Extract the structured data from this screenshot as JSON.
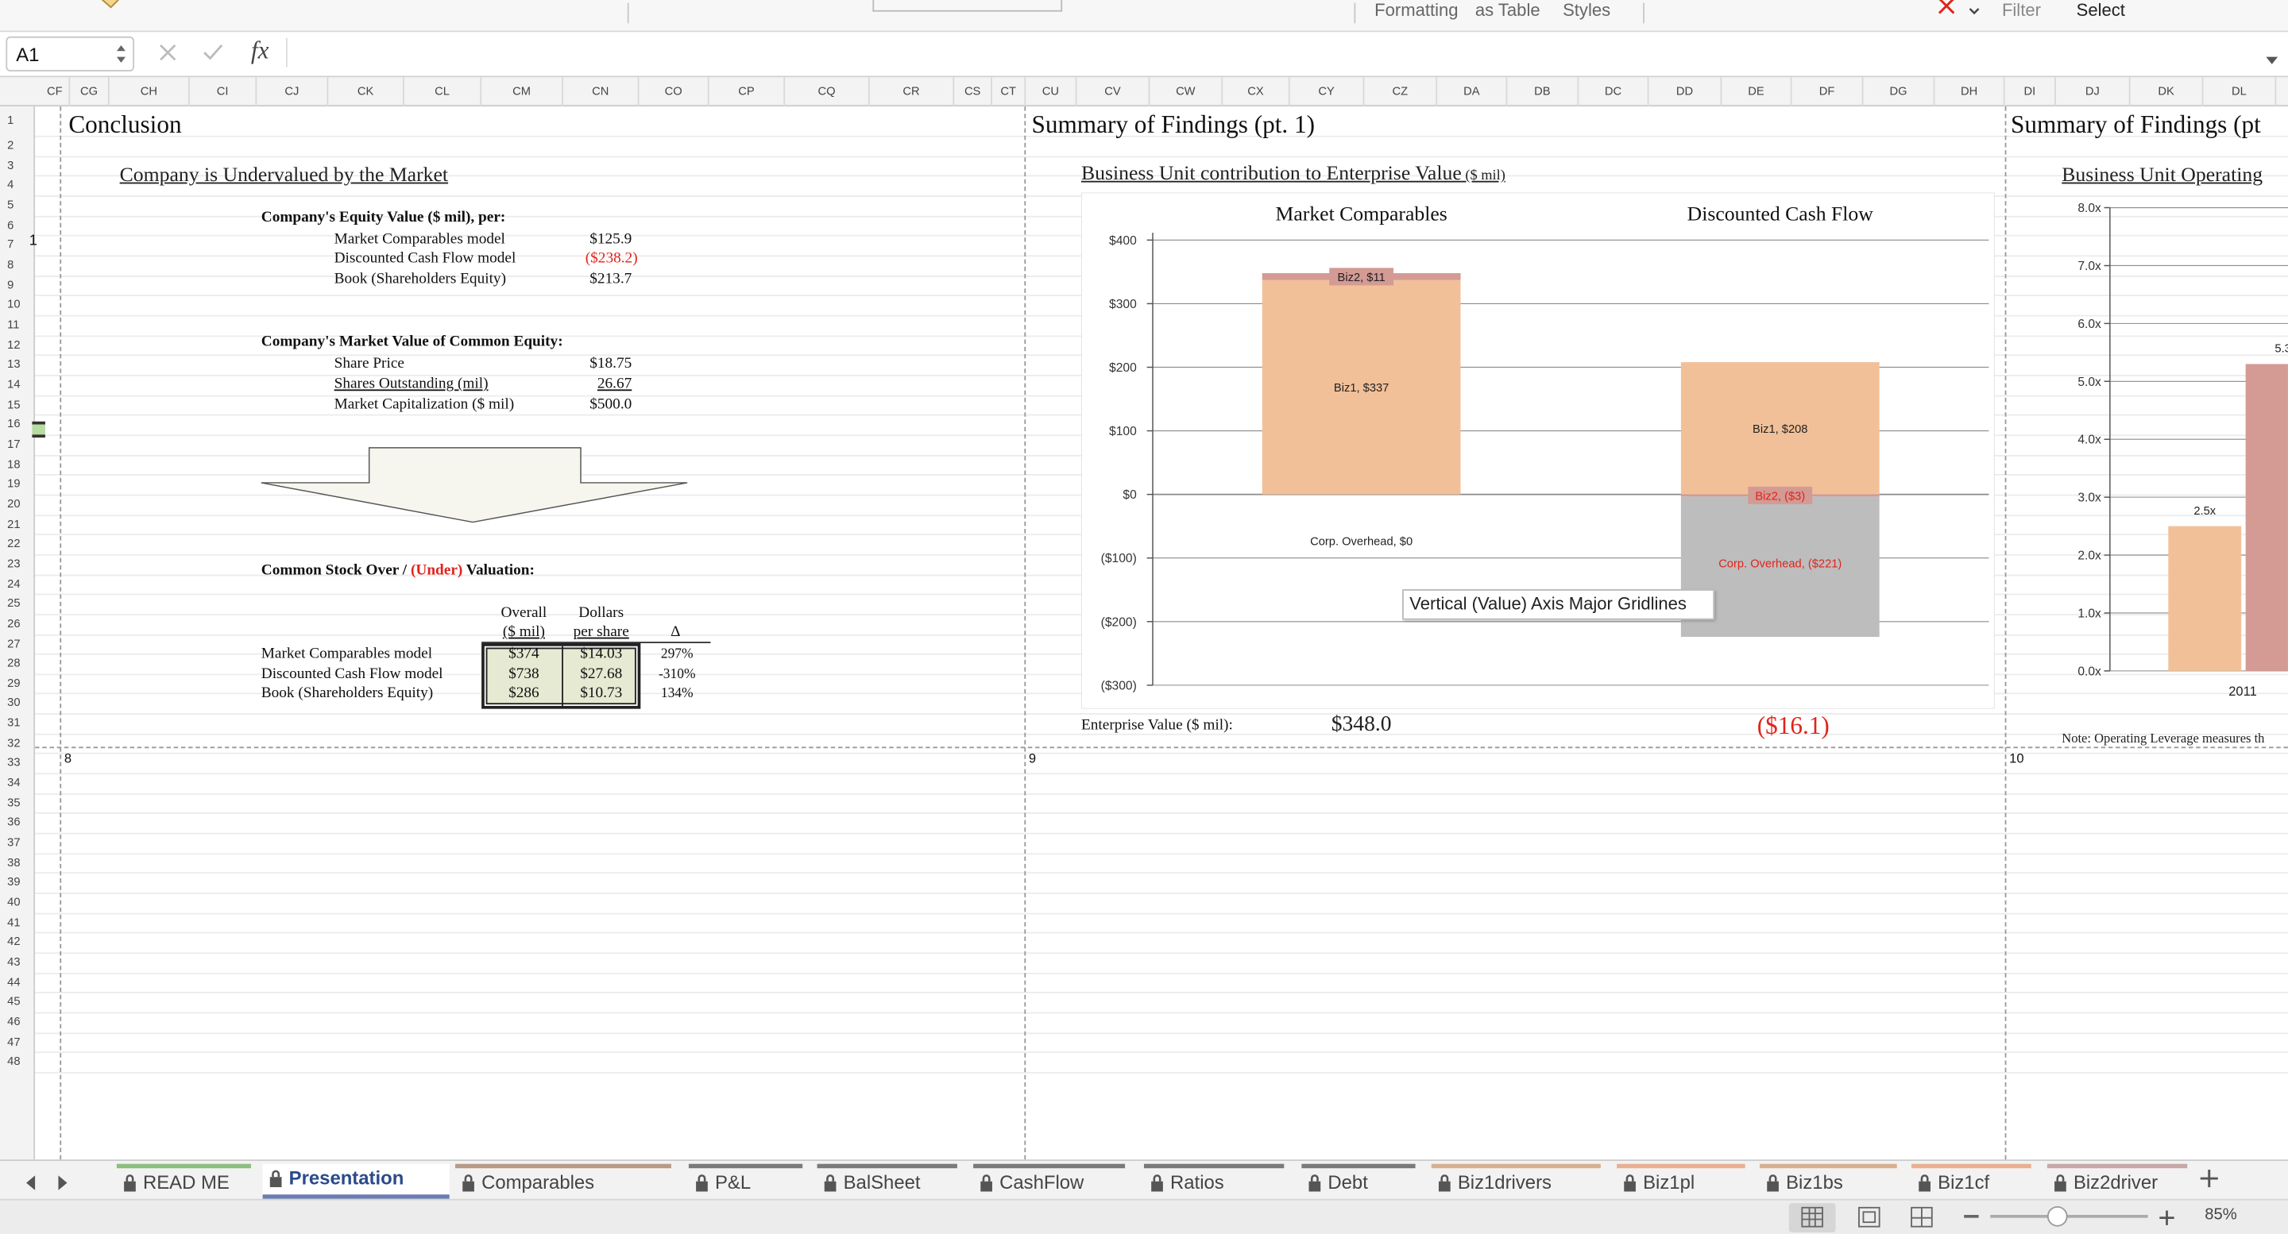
{
  "ribbon": {
    "items": [
      "Formatting",
      "as Table",
      "Styles",
      "Filter",
      "Select"
    ]
  },
  "formula_bar": {
    "name_box": "A1",
    "fx_label": "fx",
    "formula": ""
  },
  "columns": [
    "CF",
    "CG",
    "CH",
    "CI",
    "CJ",
    "CK",
    "CL",
    "CM",
    "CN",
    "CO",
    "CP",
    "CQ",
    "CR",
    "CS",
    "CT",
    "CU",
    "CV",
    "CW",
    "CX",
    "CY",
    "CZ",
    "DA",
    "DB",
    "DC",
    "DD",
    "DE",
    "DF",
    "DG",
    "DH",
    "DI",
    "DJ",
    "DK",
    "DL"
  ],
  "rows": [
    "1",
    "2",
    "3",
    "4",
    "5",
    "6",
    "7",
    "8",
    "9",
    "10",
    "11",
    "12",
    "13",
    "14",
    "15",
    "16",
    "17",
    "18",
    "19",
    "20",
    "21",
    "22",
    "23",
    "24",
    "25",
    "26",
    "27",
    "28",
    "29",
    "30",
    "31",
    "32",
    "33",
    "34",
    "35",
    "36",
    "37",
    "38",
    "39",
    "40",
    "41",
    "42",
    "43",
    "44",
    "45",
    "46",
    "47",
    "48"
  ],
  "page_numbers": [
    "8",
    "9",
    "10"
  ],
  "conclusion": {
    "title": "Conclusion",
    "subtitle": "Company is Undervalued by the Market",
    "equity_value": {
      "header": "Company's Equity Value ($ mil), per:",
      "rows": [
        {
          "label": "Market Comparables model",
          "value": "$125.9"
        },
        {
          "label": "Discounted Cash Flow model",
          "value": "($238.2)"
        },
        {
          "label": "Book (Shareholders Equity)",
          "value": "$213.7"
        }
      ]
    },
    "market_value": {
      "header": "Company's Market Value of Common Equity:",
      "rows": [
        {
          "label": "Share Price",
          "value": "$18.75"
        },
        {
          "label": "Shares Outstanding (mil)",
          "value": "26.67"
        },
        {
          "label": "Market Capitalization ($ mil)",
          "value": "$500.0"
        }
      ]
    },
    "valuation": {
      "header_a": "Common Stock Over / ",
      "header_b": "(Under)",
      "header_c": " Valuation:",
      "col1_a": "Overall",
      "col1_b": "($ mil)",
      "col2_a": "Dollars",
      "col2_b": "per share",
      "col3": "Δ",
      "rows": [
        {
          "label": "Market Comparables model",
          "overall": "$374",
          "per_share": "$14.03",
          "delta": "297%"
        },
        {
          "label": "Discounted Cash Flow model",
          "overall": "$738",
          "per_share": "$27.68",
          "delta": "-310%"
        },
        {
          "label": "Book (Shareholders Equity)",
          "overall": "$286",
          "per_share": "$10.73",
          "delta": "134%"
        }
      ]
    }
  },
  "summary1": {
    "title": "Summary of Findings (pt. 1)",
    "subtitle_main": "Business Unit contribution to Enterprise Value",
    "subtitle_unit": " ($ mil)",
    "ev_label": "Enterprise Value ($ mil):",
    "ev_values": [
      "$348.0",
      "($16.1)"
    ]
  },
  "summary2": {
    "title": "Summary of Findings (pt",
    "subtitle": "Business Unit Operating",
    "note": "Note: Operating Leverage measures th"
  },
  "chart_data": [
    {
      "type": "bar",
      "stacked": true,
      "categories": [
        "Market Comparables",
        "Discounted Cash Flow"
      ],
      "series": [
        {
          "name": "Biz1",
          "values": [
            337,
            208
          ],
          "color": "#f2c098"
        },
        {
          "name": "Biz2",
          "values": [
            11,
            -3
          ],
          "color": "#d49a94"
        },
        {
          "name": "Corp. Overhead",
          "values": [
            0,
            -221
          ],
          "color": "#bdbdbd"
        }
      ],
      "data_labels": [
        [
          "Biz1, $337",
          "Biz2, $11",
          "Corp. Overhead, $0"
        ],
        [
          "Biz1, $208",
          "Biz2, ($3)",
          "Corp. Overhead, ($221)"
        ]
      ],
      "yticks": [
        "$400",
        "$300",
        "$200",
        "$100",
        "$0",
        "($100)",
        "($200)",
        "($300)"
      ],
      "ylim": [
        -300,
        400
      ],
      "grid": true
    },
    {
      "type": "bar",
      "categories": [
        "2011"
      ],
      "series": [
        {
          "values": [
            2.5
          ],
          "color": "#f2c098"
        },
        {
          "values": [
            5.3
          ],
          "color": "#d49a94"
        }
      ],
      "data_labels": [
        "2.5x",
        "5.3"
      ],
      "yticks": [
        "8.0x",
        "7.0x",
        "6.0x",
        "5.0x",
        "4.0x",
        "3.0x",
        "2.0x",
        "1.0x",
        "0.0x"
      ],
      "ylim": [
        0,
        8
      ],
      "grid": true
    }
  ],
  "tooltip": "Vertical (Value) Axis Major Gridlines",
  "sheet_tabs": [
    "READ ME",
    "Presentation",
    "Comparables",
    "P&L",
    "BalSheet",
    "CashFlow",
    "Ratios",
    "Debt",
    "Biz1drivers",
    "Biz1pl",
    "Biz1bs",
    "Biz1cf",
    "Biz2driver"
  ],
  "active_tab": "Presentation",
  "zoom": "85%",
  "colors": {
    "accent_tab_underline": "#6b7db3",
    "negative": "#e0241b",
    "highlight_cells": "#e6ead2"
  }
}
